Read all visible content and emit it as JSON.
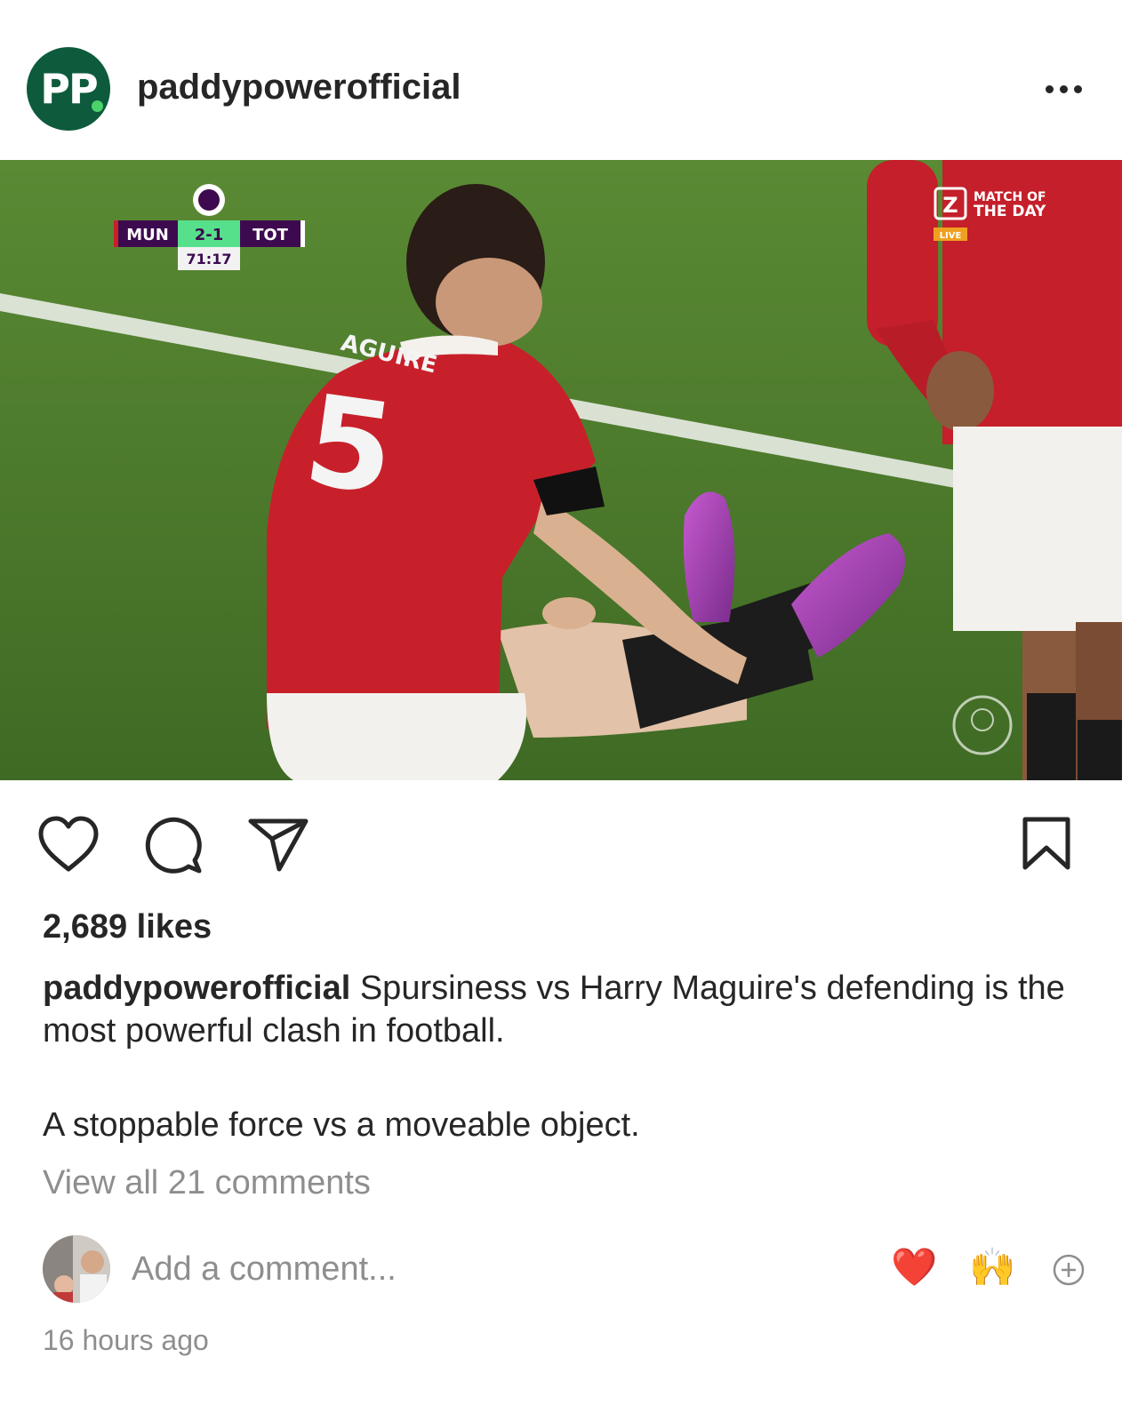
{
  "post": {
    "username": "paddypowerofficial",
    "avatar_text": "PP",
    "likes": "2,689 likes",
    "caption_username": "paddypowerofficial",
    "caption_text": " Spursiness vs Harry Maguire's defending is the most powerful clash in football.",
    "caption_second": "A stoppable force vs a moveable object.",
    "view_comments": "View all 21 comments",
    "timestamp": "16 hours ago"
  },
  "image": {
    "scoreboard": {
      "home": "MUN",
      "score": "2-1",
      "away": "TOT",
      "clock": "71:17"
    },
    "broadcaster": {
      "line1": "MATCH OF",
      "line2": "THE DAY",
      "badge": "LIVE",
      "logo": "Z"
    },
    "shirt_name": "AGUIRE",
    "shirt_number": "5"
  },
  "comment_box": {
    "placeholder": "Add a comment...",
    "emoji_1": "❤️",
    "emoji_2": "🙌",
    "add_icon": "plus-circle-icon"
  },
  "icons": {
    "like": "heart-icon",
    "comment": "comment-bubble-icon",
    "share": "send-icon",
    "save": "bookmark-icon",
    "more": "more-dots-icon"
  },
  "colors": {
    "brand_green": "#0d5b3c",
    "text": "#262626",
    "muted": "#8e8e8e",
    "scoreboard_purple": "#3d0a4f",
    "scoreboard_green": "#57e08c"
  }
}
